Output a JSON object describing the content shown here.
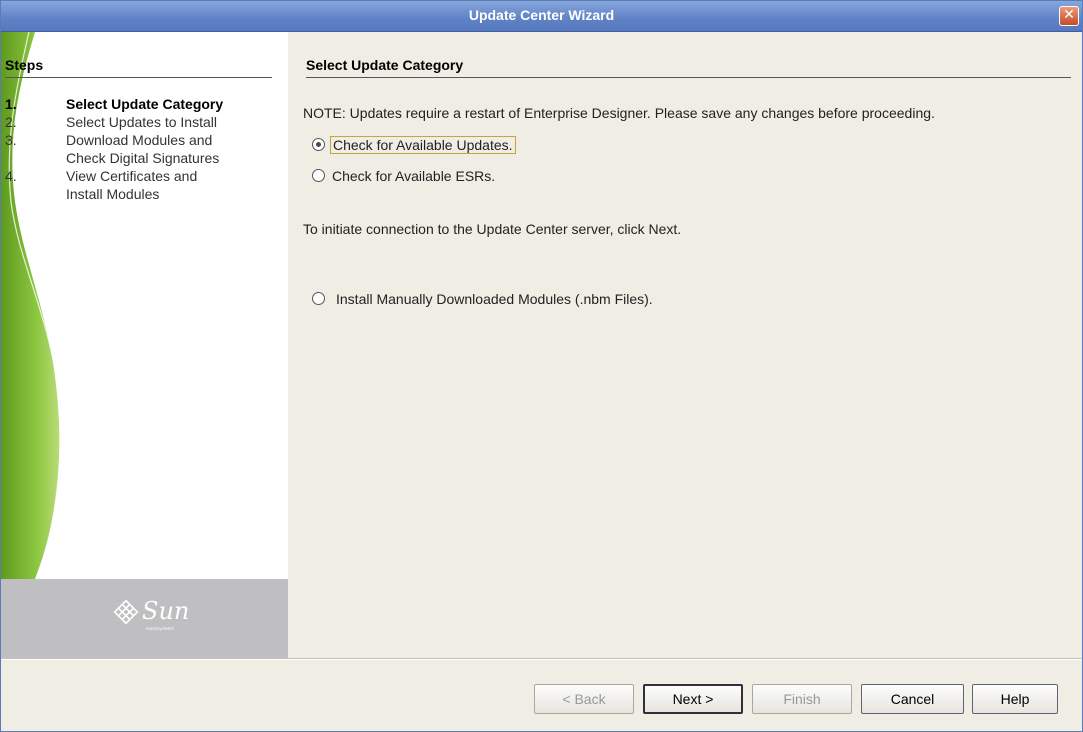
{
  "window": {
    "title": "Update Center Wizard",
    "close_glyph": "✕"
  },
  "steps": {
    "heading": "Steps",
    "items": [
      {
        "num": "1.",
        "lines": [
          "Select Update Category"
        ],
        "active": true
      },
      {
        "num": "2.",
        "lines": [
          "Select Updates to Install"
        ],
        "active": false
      },
      {
        "num": "3.",
        "lines": [
          "Download Modules and",
          "Check Digital Signatures"
        ],
        "active": false
      },
      {
        "num": "4.",
        "lines": [
          "View Certificates and",
          "Install Modules"
        ],
        "active": false
      }
    ]
  },
  "logo": {
    "text": "Sun",
    "subtext": "microsystems",
    "icon": "sun-microsystems-logo-icon"
  },
  "content": {
    "title": "Select Update Category",
    "note": "NOTE: Updates require a restart of Enterprise Designer. Please save any changes before proceeding.",
    "options": [
      {
        "label": "Check for Available Updates.",
        "checked": true
      },
      {
        "label": "Check for Available ESRs.",
        "checked": false
      }
    ],
    "info": "To initiate connection to the Update Center server, click Next.",
    "manual_option": {
      "label": "Install Manually Downloaded Modules (.nbm Files).",
      "checked": false
    }
  },
  "buttons": {
    "back": {
      "label": "< Back",
      "enabled": false
    },
    "next": {
      "label": "Next >",
      "enabled": true
    },
    "finish": {
      "label": "Finish",
      "enabled": false
    },
    "cancel": {
      "label": "Cancel",
      "enabled": true
    },
    "help": {
      "label": "Help",
      "enabled": true
    }
  },
  "colors": {
    "titlebar": "#5f82c6",
    "panel": "#efede4",
    "wave_green": "#7cba2c",
    "logo_bg": "#bfbfc1"
  }
}
